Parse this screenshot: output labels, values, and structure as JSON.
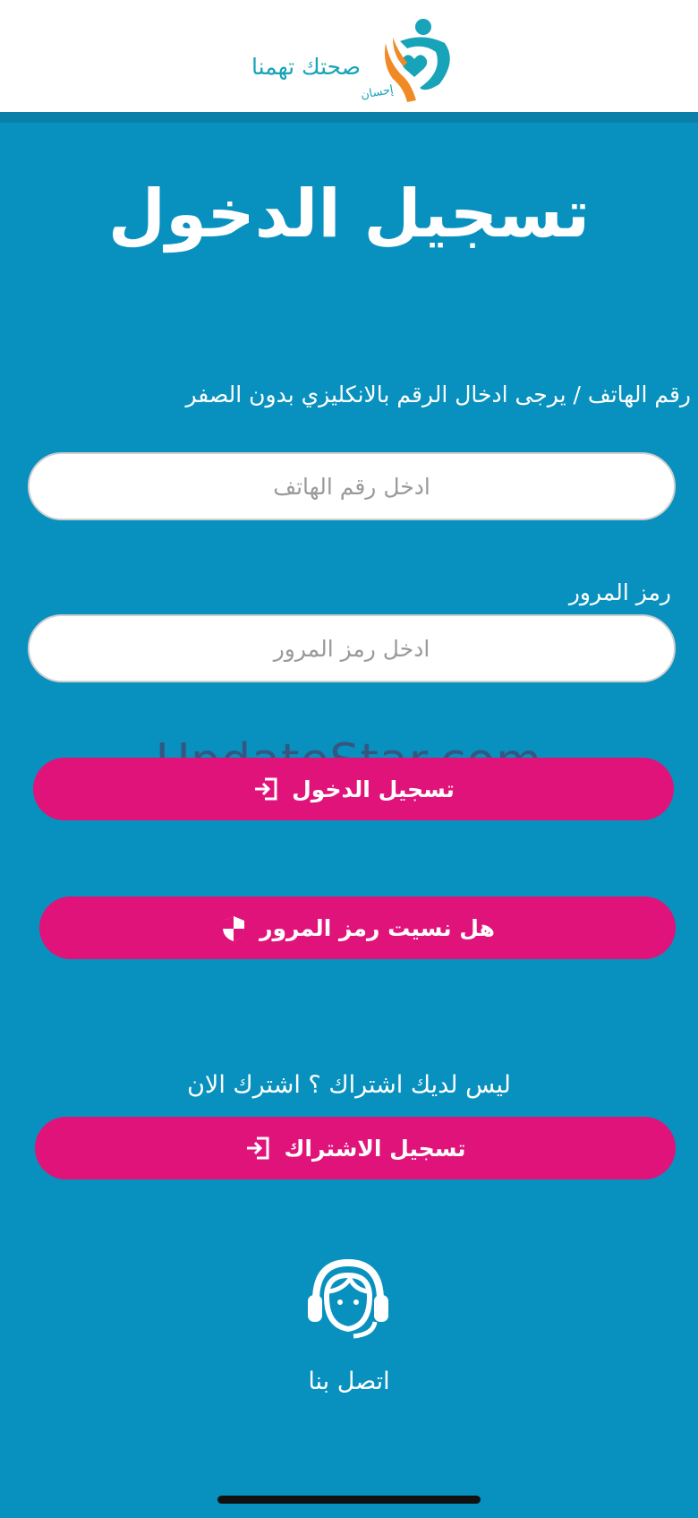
{
  "header": {
    "logo_text": "صحتك تهمنا",
    "logo_subtext": "إحسان"
  },
  "page_title": "تسجيل الدخول",
  "phone": {
    "label": "رقم الهاتف / يرجى ادخال الرقم بالانكليزي بدون الصفر",
    "placeholder": "ادخل رقم الهاتف",
    "value": ""
  },
  "password": {
    "label": "رمز المرور",
    "placeholder": "ادخل رمز المرور",
    "value": ""
  },
  "buttons": {
    "login": "تسجيل الدخول",
    "forgot_password": "هل نسيت رمز المرور",
    "register": "تسجيل الاشتراك"
  },
  "subscribe_question": "ليس لديك اشتراك ؟ اشترك الان",
  "contact_label": "اتصل بنا",
  "watermark": "UpdateStar.com",
  "colors": {
    "background": "#0891be",
    "button": "#e0137a",
    "header": "#ffffff"
  },
  "icons": [
    "login-icon",
    "shield-icon",
    "register-icon",
    "headset-support-icon",
    "heart-hands-logo-icon"
  ]
}
